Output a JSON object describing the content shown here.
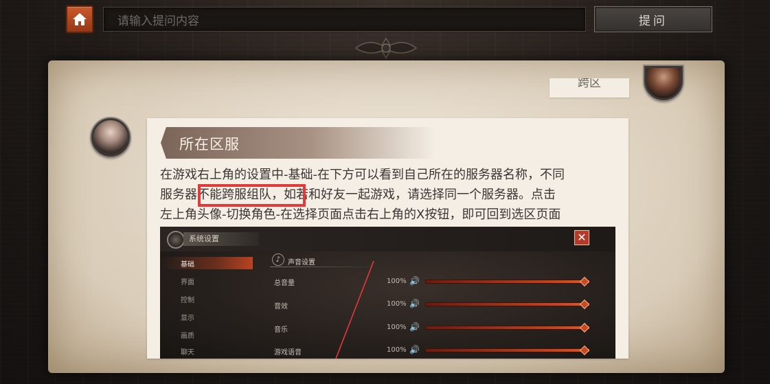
{
  "topbar": {
    "search_placeholder": "请输入提问内容",
    "ask_button": "提问"
  },
  "parchment": {
    "partial_tab_label": "跨区"
  },
  "card": {
    "title": "所在区服",
    "body_line_1": "在游戏右上角的设置中-基础-在下方可以看到自己所在的服务器名称，不同",
    "body_line_2": "服务器不能跨服组队，如若和好友一起游戏，请选择同一个服务器。点击",
    "body_line_3": "左上角头像-切换角色-在选择页面点击右上角的X按钮，即可回到选区页面",
    "highlighted_phrase": "不能跨服组队，"
  },
  "settings_panel": {
    "title": "系统设置",
    "close_symbol": "✕",
    "nav": [
      {
        "label": "基础",
        "active": true
      },
      {
        "label": "界面",
        "active": false
      },
      {
        "label": "控制",
        "active": false
      },
      {
        "label": "显示",
        "active": false
      },
      {
        "label": "画质",
        "active": false
      },
      {
        "label": "聊天",
        "active": false
      }
    ],
    "section_title": "声音设置",
    "rows": [
      {
        "label": "总音量",
        "value": "100%",
        "level": 1.0
      },
      {
        "label": "音效",
        "value": "100%",
        "level": 1.0
      },
      {
        "label": "音乐",
        "value": "100%",
        "level": 1.0
      },
      {
        "label": "游戏语音",
        "value": "100%",
        "level": 1.0
      }
    ]
  },
  "colors": {
    "accent_orange": "#c95a2c",
    "highlight_red": "#e23a3a",
    "parchment": "#efe7da",
    "card_text": "#3a3532"
  },
  "icons": {
    "home": "home-icon",
    "close": "close-icon",
    "speaker": "speaker-icon",
    "sound_section": "music-note-icon"
  }
}
